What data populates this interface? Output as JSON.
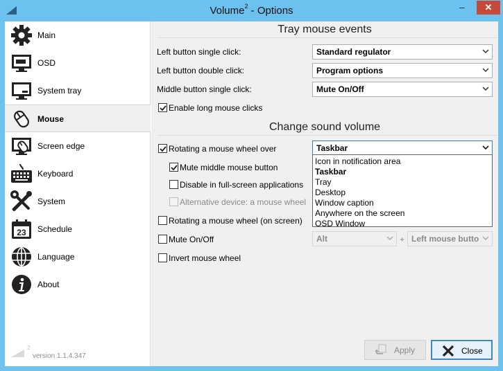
{
  "window": {
    "title_main": "Volume",
    "title_sup": "2",
    "title_rest": " - Options",
    "minimize": "–",
    "close": "✕"
  },
  "sidebar": {
    "items": [
      {
        "label": "Main",
        "icon": "gear-icon"
      },
      {
        "label": "OSD",
        "icon": "monitor-icon"
      },
      {
        "label": "System tray",
        "icon": "system-tray-icon"
      },
      {
        "label": "Mouse",
        "icon": "mouse-icon",
        "active": true
      },
      {
        "label": "Screen edge",
        "icon": "screen-edge-icon"
      },
      {
        "label": "Keyboard",
        "icon": "keyboard-icon"
      },
      {
        "label": "System",
        "icon": "tools-icon"
      },
      {
        "label": "Schedule",
        "icon": "calendar-icon",
        "badge": "23"
      },
      {
        "label": "Language",
        "icon": "globe-icon"
      },
      {
        "label": "About",
        "icon": "info-icon"
      }
    ],
    "version": "version 1.1.4.347",
    "logo_sup": "2"
  },
  "tray": {
    "title": "Tray mouse events",
    "left_single_label": "Left button single click:",
    "left_single_value": "Standard regulator",
    "left_double_label": "Left button double click:",
    "left_double_value": "Program options",
    "middle_single_label": "Middle button single click:",
    "middle_single_value": "Mute On/Off",
    "long_clicks_label": "Enable long mouse clicks",
    "long_clicks_checked": true
  },
  "sound": {
    "title": "Change sound volume",
    "wheel_over_label": "Rotating a mouse wheel over",
    "wheel_over_checked": true,
    "wheel_over_value": "Taskbar",
    "dropdown_options": [
      "Icon in notification area",
      "Taskbar",
      "Tray",
      "Desktop",
      "Window caption",
      "Anywhere on the screen",
      "OSD Window"
    ],
    "dropdown_selected": "Taskbar",
    "mute_middle_label": "Mute middle mouse button",
    "mute_middle_checked": true,
    "disable_fullscreen_label": "Disable in full-screen applications",
    "disable_fullscreen_checked": false,
    "alt_device_label": "Alternative device: a mouse wheel",
    "alt_device_checked": false,
    "wheel_screen_label": "Rotating a mouse wheel (on screen)",
    "wheel_screen_checked": false,
    "mute_onoff_label": "Mute On/Off",
    "mute_onoff_checked": false,
    "mute_key_value": "Alt",
    "plus": "+",
    "mute_button_value": "Left mouse butto",
    "invert_label": "Invert mouse wheel",
    "invert_checked": false
  },
  "buttons": {
    "apply": "Apply",
    "close": "Close"
  },
  "colors": {
    "titlebar": "#6cc1ef",
    "close_button": "#c7493a",
    "focus_border": "#3c7fb1"
  }
}
